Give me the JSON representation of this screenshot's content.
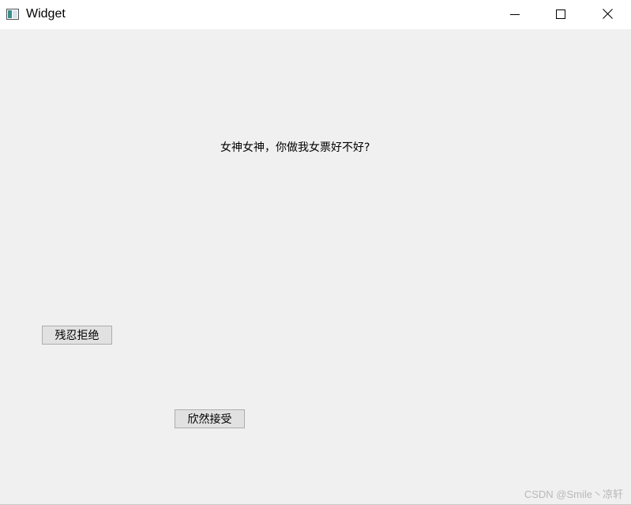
{
  "window": {
    "title": "Widget",
    "icons": {
      "app": "app-icon",
      "minimize": "minimize-icon",
      "maximize": "maximize-icon",
      "close": "close-icon"
    }
  },
  "content": {
    "question": "女神女神，你做我女票好不好?",
    "reject_label": "残忍拒绝",
    "accept_label": "欣然接受"
  },
  "watermark": "CSDN @Smile丶凉轩",
  "colors": {
    "titlebar": "#ffffff",
    "background": "#f0f0f0",
    "button_face": "#e1e1e1",
    "button_border": "#adadad",
    "watermark": "#b8b8b8"
  }
}
